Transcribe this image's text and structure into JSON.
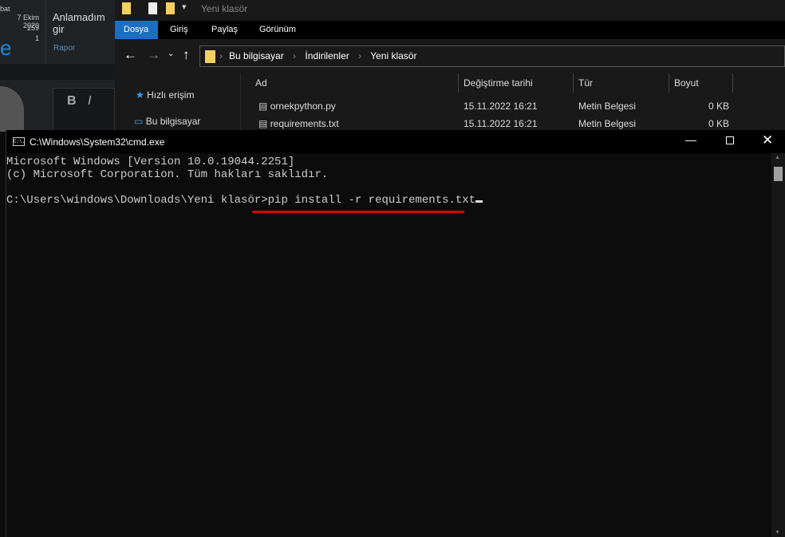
{
  "forum": {
    "lines": [
      "bat",
      "7 Ekim 2020",
      "259",
      "1"
    ],
    "post_title": "Anlamadım gir",
    "report": "Rapor",
    "bold": "B",
    "italic": "I",
    "logo_letter": "e"
  },
  "explorer": {
    "title": "Yeni klasör",
    "tabs": [
      "Dosya",
      "Giriş",
      "Paylaş",
      "Görünüm"
    ],
    "breadcrumb": [
      "Bu bilgisayar",
      "İndirilenler",
      "Yeni klasör"
    ],
    "nav": [
      "Hızlı erişim",
      "Bu bilgisayar"
    ],
    "columns": [
      "Ad",
      "Değiştirme tarihi",
      "Tür",
      "Boyut"
    ],
    "files": [
      {
        "name": "ornekpython.py",
        "date": "15.11.2022 16:21",
        "type": "Metin Belgesi",
        "size": "0 KB"
      },
      {
        "name": "requirements.txt",
        "date": "15.11.2022 16:21",
        "type": "Metin Belgesi",
        "size": "0 KB"
      }
    ]
  },
  "cmd": {
    "title": "C:\\Windows\\System32\\cmd.exe",
    "icon_text": "C:\\.",
    "line1": "Microsoft Windows [Version 10.0.19044.2251]",
    "line2": "(c) Microsoft Corporation. Tüm hakları saklıdır.",
    "prompt": "C:\\Users\\windows\\Downloads\\Yeni klasör>",
    "command": "pip install -r requirements.txt",
    "underline_color": "#e00000"
  }
}
